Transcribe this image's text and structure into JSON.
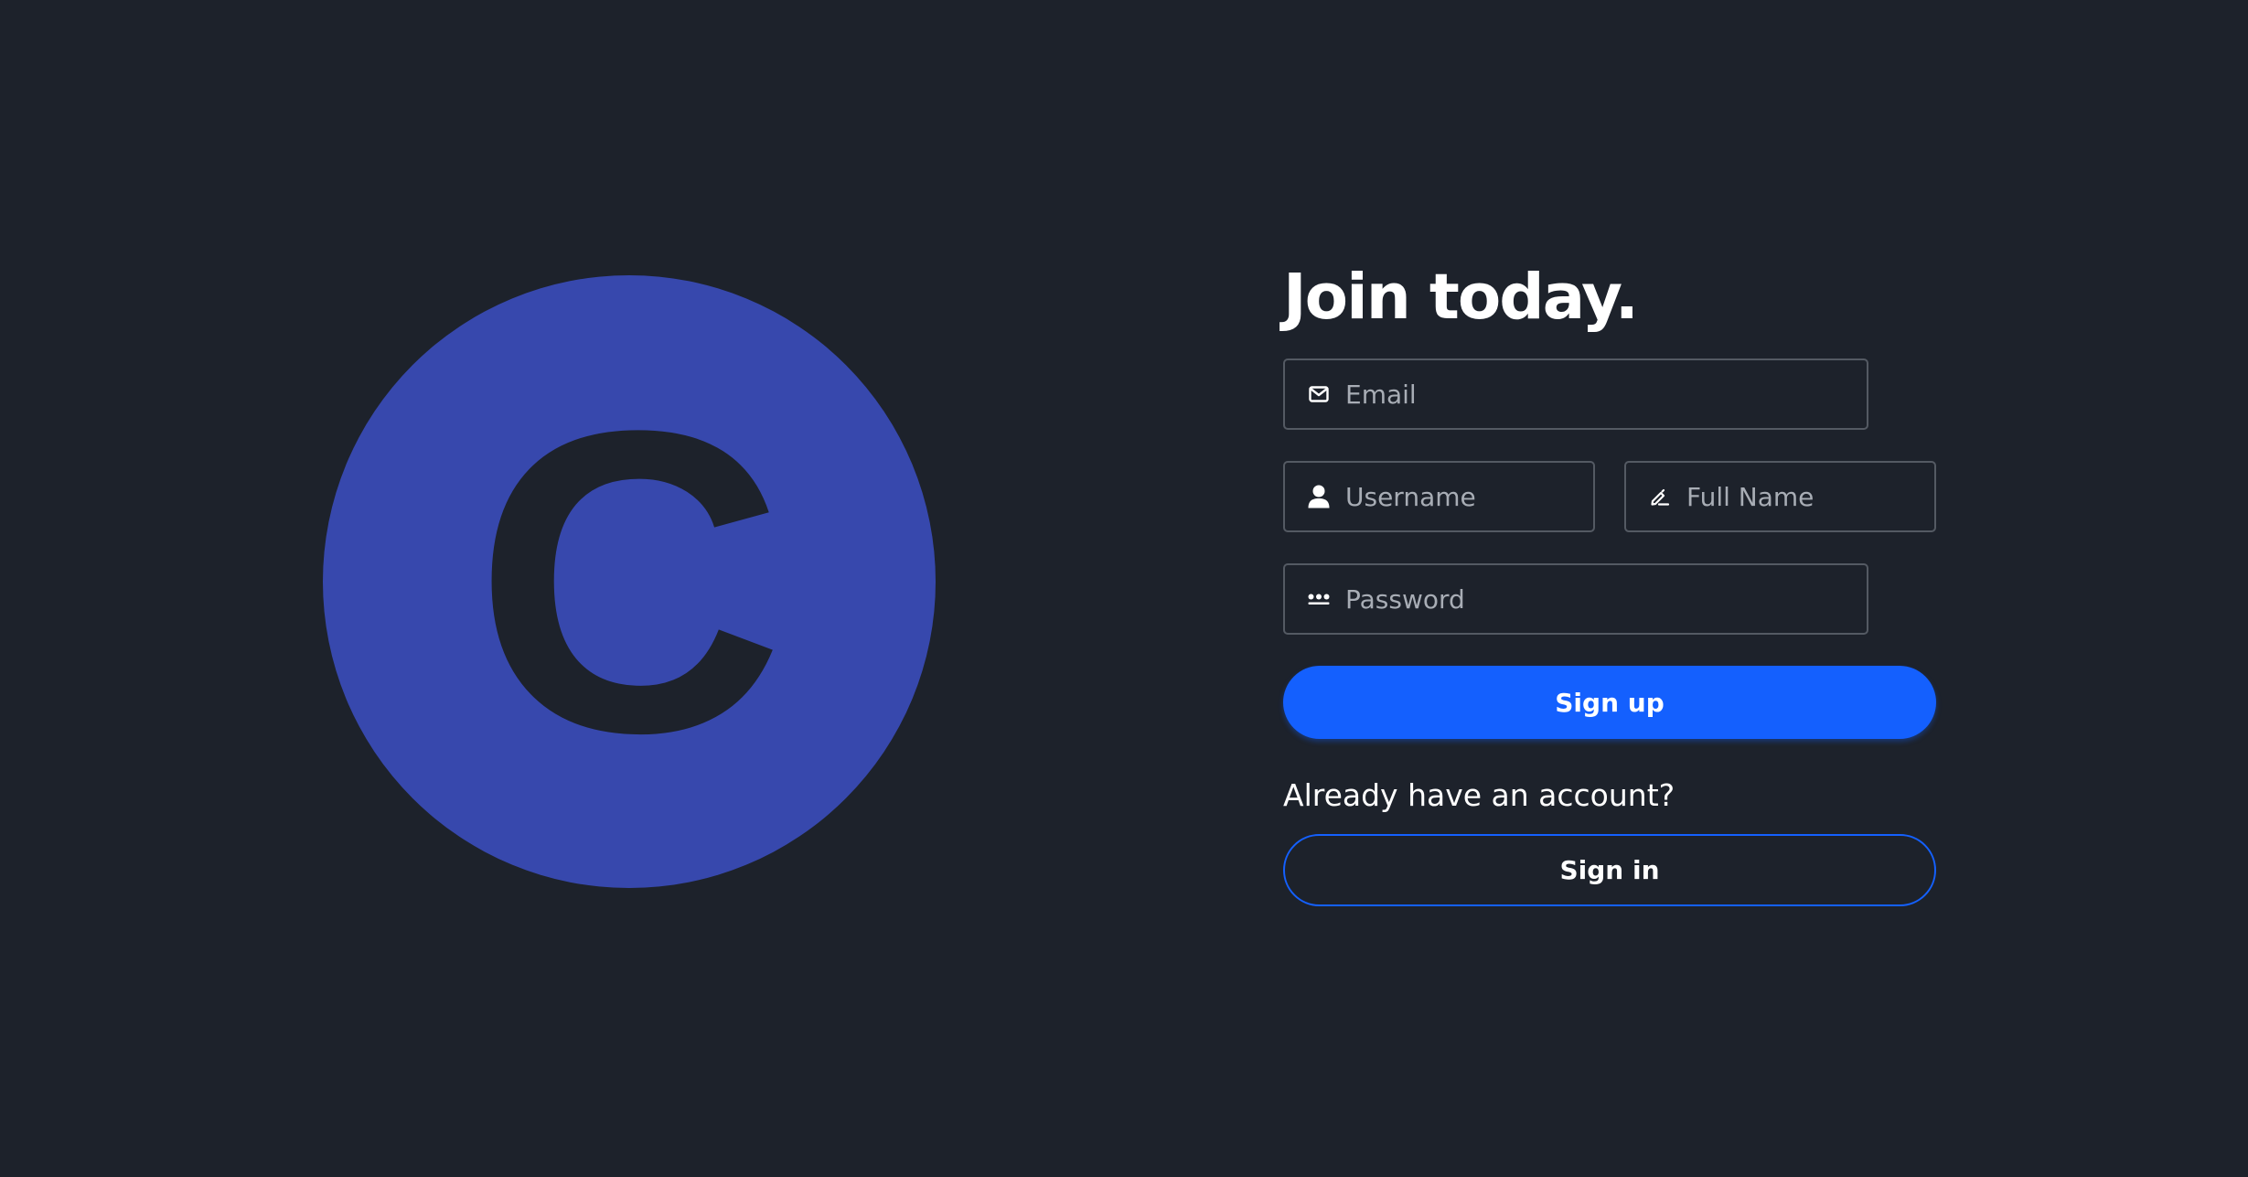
{
  "brand": {
    "logo_letter": "C",
    "logo_icon": "c-logo-circle",
    "circle_color": "#3748ad",
    "letter_color": "#1d222b"
  },
  "signup": {
    "title": "Join today.",
    "email": {
      "placeholder": "Email",
      "value": "",
      "icon": "envelope-icon"
    },
    "username": {
      "placeholder": "Username",
      "value": "",
      "icon": "person-icon"
    },
    "full_name": {
      "placeholder": "Full Name",
      "value": "",
      "icon": "pencil-icon"
    },
    "password": {
      "placeholder": "Password",
      "value": "",
      "icon": "dots-icon"
    },
    "submit_label": "Sign up"
  },
  "signin": {
    "prompt": "Already have an account?",
    "button_label": "Sign in"
  },
  "colors": {
    "background": "#1d222b",
    "accent": "#1460fe",
    "input_border": "#545a63",
    "placeholder": "#a8adb5",
    "text": "#ffffff"
  }
}
